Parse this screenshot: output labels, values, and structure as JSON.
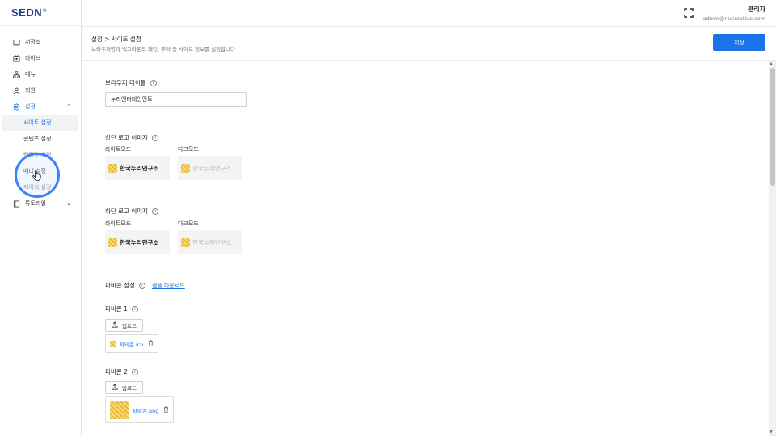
{
  "brand": {
    "logo": "SEDN",
    "logo_mark": "®"
  },
  "sidebar": {
    "items": [
      {
        "label": "저장소",
        "icon": "storage-icon"
      },
      {
        "label": "라이브",
        "icon": "live-icon"
      },
      {
        "label": "메뉴",
        "icon": "menu-tree-icon"
      },
      {
        "label": "회원",
        "icon": "user-icon"
      },
      {
        "label": "설정",
        "icon": "gear-icon"
      }
    ],
    "settings_sub": [
      {
        "label": "사이트 설정"
      },
      {
        "label": "콘텐츠 설정"
      },
      {
        "label": "템플릿 설정"
      },
      {
        "label": "배너 설정"
      },
      {
        "label": "페이지 설정"
      }
    ],
    "tutorial": {
      "label": "튜토리얼",
      "icon": "book-icon"
    }
  },
  "header": {
    "user_name": "관리자",
    "user_email": "admin@nucreative.com"
  },
  "page": {
    "breadcrumb": "설정 > 사이트 설정",
    "subtitle": "브라우저명과 백그라운드 패턴, 푸터 등 사이트 정보를 설정합니다",
    "save_label": "저장"
  },
  "form": {
    "browser_title": {
      "label": "브라우저 타이틀",
      "value": "누리엔터테인먼트"
    },
    "top_logo": {
      "label": "상단 로고 이미지",
      "light_label": "라이트모드",
      "dark_label": "다크모드",
      "logo_text": "한국누리연구소"
    },
    "bottom_logo": {
      "label": "하단 로고 이미지",
      "light_label": "라이트모드",
      "dark_label": "다크모드",
      "logo_text": "한국누리연구소"
    },
    "favicon": {
      "label": "파비콘 설정",
      "sample_link": "샘플 다운로드",
      "favicon1": {
        "label": "파비콘 1",
        "upload_label": "업로드",
        "file": "파비콘.ico"
      },
      "favicon2": {
        "label": "파비콘 2",
        "upload_label": "업로드",
        "file": "파비콘.png"
      }
    }
  },
  "colors": {
    "accent": "#1a73e8",
    "brand": "#1f3a8a",
    "click_ring": "#3b82f6"
  }
}
